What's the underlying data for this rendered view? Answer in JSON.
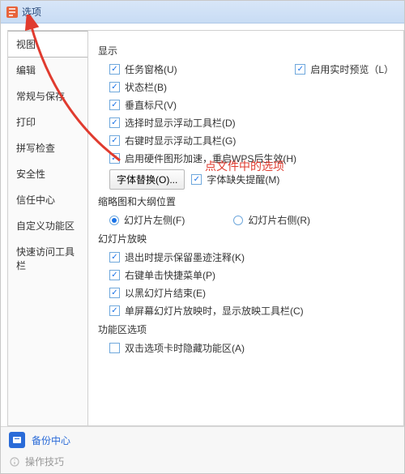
{
  "window": {
    "title": "选项"
  },
  "sidebar": {
    "items": [
      {
        "label": "视图"
      },
      {
        "label": "编辑"
      },
      {
        "label": "常规与保存"
      },
      {
        "label": "打印"
      },
      {
        "label": "拼写检查"
      },
      {
        "label": "安全性"
      },
      {
        "label": "信任中心"
      },
      {
        "label": "自定义功能区"
      },
      {
        "label": "快速访问工具栏"
      }
    ]
  },
  "main": {
    "display_title": "显示",
    "task_pane": "任务窗格(U)",
    "realtime_preview": "启用实时预览（L）",
    "status_bar": "状态栏(B)",
    "vertical_ruler": "垂直标尺(V)",
    "float_toolbar_select": "选择时显示浮动工具栏(D)",
    "float_toolbar_right": "右键时显示浮动工具栏(G)",
    "hw_accel": "启用硬件图形加速，重启WPS后生效(H)",
    "font_replace_btn": "字体替换(O)...",
    "font_missing_warn": "字体缺失提醒(M)",
    "thumb_title": "缩略图和大纲位置",
    "slide_left": "幻灯片左侧(F)",
    "slide_right": "幻灯片右侧(R)",
    "slideshow_title": "幻灯片放映",
    "exit_prompt": "退出时提示保留墨迹注释(K)",
    "rightclick_menu": "右键单击快捷菜单(P)",
    "black_end": "以黑幻灯片结束(E)",
    "single_show_toolbar": "单屏幕幻灯片放映时，显示放映工具栏(C)",
    "ribbon_title": "功能区选项",
    "dblclick_hide": "双击选项卡时隐藏功能区(A)"
  },
  "overlay": "点文件中的选项",
  "footer": {
    "backup": "备份中心",
    "tips": "操作技巧"
  }
}
